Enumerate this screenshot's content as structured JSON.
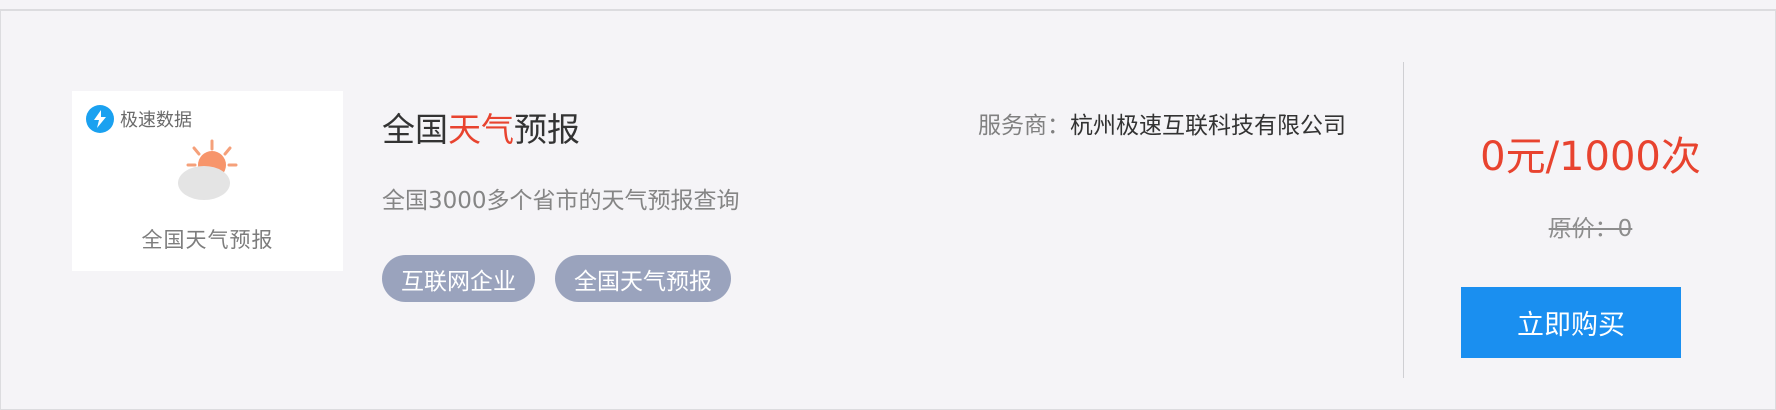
{
  "product": {
    "thumbnail": {
      "brand": "极速数据",
      "caption": "全国天气预报",
      "icon": "weather-sun-cloud-icon",
      "brand_icon": "lightning-bolt-icon"
    },
    "title_prefix": "全国",
    "title_highlight": "天气",
    "title_suffix": "预报",
    "provider_label": "服务商：",
    "provider_name": "杭州极速互联科技有限公司",
    "description": "全国3000多个省市的天气预报查询",
    "tags": [
      "互联网企业",
      "全国天气预报"
    ]
  },
  "pricing": {
    "price": "0元/1000次",
    "original_price": "原价：0",
    "buy_label": "立即购买"
  },
  "colors": {
    "highlight": "#e8432f",
    "button": "#1a8ff0",
    "tag_bg": "#9aa3bd",
    "card_bg": "#f5f4f7"
  }
}
